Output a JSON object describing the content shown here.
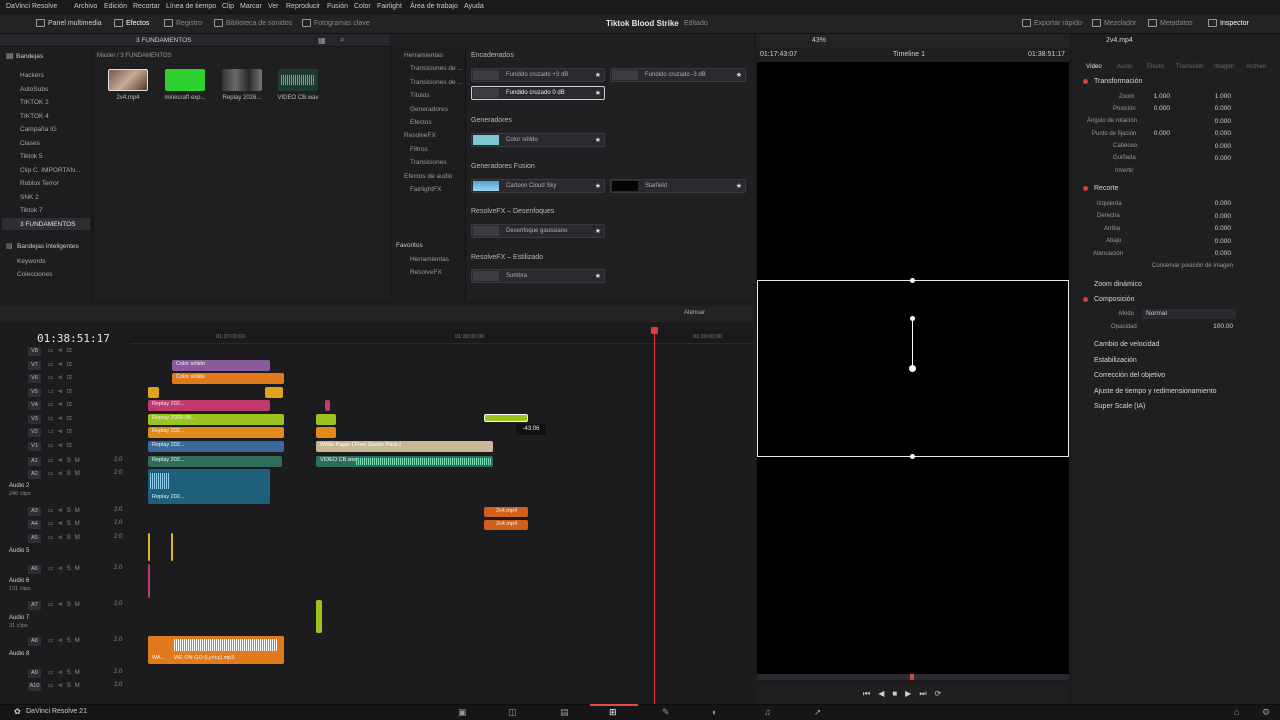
{
  "menubar": {
    "items": [
      "DaVinci Resolve",
      "Archivo",
      "Edición",
      "Recortar",
      "Línea de tiempo",
      "Clip",
      "Marcar",
      "Ver",
      "Reproducir",
      "Fusión",
      "Color",
      "Fairlight",
      "Área de trabajo",
      "Ayuda"
    ]
  },
  "toolbar": {
    "left": [
      "Panel multimedia",
      "Efectos",
      "Registro",
      "Biblioteca de sonidos",
      "Fotogramas clave"
    ],
    "project_title": "Tiktok Blood Strike",
    "project_status": "Editado",
    "right": [
      "Exportar rápido",
      "Mezclador",
      "Metadatos",
      "Inspector"
    ]
  },
  "media_pool": {
    "header": "Bandejas",
    "current_bin": "3 FUNDAMENTOS",
    "path": "Master / 3 FUNDAMENTOS",
    "bins": [
      "Hackers",
      "AutoSubs",
      "TIKTOK 2",
      "TIKTOK 4",
      "Campaña IG",
      "Clases",
      "Tiktok 5",
      "Clip C. IMPORTAN...",
      "Roblox Terror",
      "SNK 2",
      "Tiktok 7",
      "3 FUNDAMENTOS"
    ],
    "smart_header": "Bandejas inteligentes",
    "smart_bins": [
      "Keywords",
      "Colecciones"
    ],
    "clips": [
      {
        "name": "2v4.mp4"
      },
      {
        "name": "minecraft exp..."
      },
      {
        "name": "Replay 2026..."
      },
      {
        "name": "VIDEO CB.wav"
      }
    ]
  },
  "effects": {
    "tree": [
      "Herramientas",
      "Transiciones de ...",
      "Transiciones de ...",
      "Títulos",
      "Generadores",
      "Efectos",
      "ResolveFX",
      "Filtros",
      "Transiciones",
      "Efectos de audio",
      "FairlightFX"
    ],
    "favorites_header": "Favoritos",
    "favorites": [
      "Herramientas",
      "ResolveFX"
    ],
    "sections": [
      {
        "title": "Encadenados",
        "items": [
          "Fundido cruzado +3 dB",
          "Fundido cruzado -3 dB",
          "Fundido cruzado 0 dB"
        ]
      },
      {
        "title": "Generadores",
        "items": [
          "Color sólido"
        ]
      },
      {
        "title": "Generadores Fusion",
        "items": [
          "Cartoon Cloud Sky",
          "Starfield"
        ]
      },
      {
        "title": "ResolveFX – Desenfoques",
        "items": [
          "Desenfoque gaussiano"
        ]
      },
      {
        "title": "ResolveFX – Estilizado",
        "items": [
          "Sombra"
        ]
      }
    ]
  },
  "viewer": {
    "source_tc": "01:17:43:07",
    "zoom": "43%",
    "timeline_name": "Timeline 1",
    "record_tc": "01:38:51:17"
  },
  "timeline": {
    "timecode": "01:38:51:17",
    "ruler": [
      "01:37:00:00",
      "01:38:00:00",
      "01:39:00:00"
    ],
    "mute_label": "Atenuar",
    "tooltip": "-43:06",
    "video_tracks": [
      "V8",
      "V7",
      "V6",
      "V5",
      "V4",
      "V3",
      "V2",
      "V1"
    ],
    "audio_tracks": [
      {
        "id": "A1",
        "name": "",
        "vol": "2.0"
      },
      {
        "id": "A2",
        "name": "Audio 2",
        "sub": "246 clips",
        "vol": "2.0"
      },
      {
        "id": "A3",
        "name": "",
        "vol": "2.0"
      },
      {
        "id": "A4",
        "name": "",
        "vol": "2.0"
      },
      {
        "id": "A5",
        "name": "Audio 5",
        "vol": "2.0"
      },
      {
        "id": "A6",
        "name": "Audio 6",
        "sub": "131 clips",
        "vol": "2.0"
      },
      {
        "id": "A7",
        "name": "Audio 7",
        "sub": "31 clips",
        "vol": "2.0"
      },
      {
        "id": "A8",
        "name": "Audio 8",
        "vol": "2.0"
      },
      {
        "id": "A9",
        "name": "",
        "vol": "2.0"
      },
      {
        "id": "A10",
        "name": "",
        "vol": "2.0"
      }
    ],
    "clips": {
      "color1": "Color sólido",
      "color2": "Color sólido",
      "replay": "Replay 202...",
      "replay2": "Replay 2026-08...",
      "white": "White Paper | Free Starter Pack |",
      "video_cb": "VIDEO CB.wav",
      "v2v4a": "2v4.mp4",
      "v2v4b": "2v4.mp4",
      "music": "WE ON GO (Lyrics).mp3",
      "music_short": "WA..."
    }
  },
  "inspector": {
    "clip": "2v4.mp4",
    "tabs": [
      "Vídeo",
      "Audio",
      "Efecto",
      "Transición",
      "Imagen",
      "Archivo"
    ],
    "transform": {
      "title": "Transformación",
      "zoom_label": "Zoom",
      "zoom_x": "1.000",
      "zoom_y": "1.000",
      "pos_label": "Posición",
      "pos_x": "0.000",
      "pos_y": "0.000",
      "rot_label": "Ángulo de rotación",
      "rot": "0.000",
      "anchor_label": "Punto de fijación",
      "anchor_x": "0.000",
      "anchor_y": "0.000",
      "pitch_label": "Cabeceo",
      "pitch": "0.000",
      "yaw_label": "Guiñada",
      "yaw": "0.000",
      "flip_label": "Invertir"
    },
    "crop": {
      "title": "Recorte",
      "left_label": "Izquierda",
      "left": "0.000",
      "right_label": "Derecha",
      "right": "0.000",
      "top_label": "Arriba",
      "top": "0.000",
      "bottom_label": "Abajo",
      "bottom": "0.000",
      "soft_label": "Atenuación",
      "soft": "0.000",
      "retain": "Conservar posición de imagen"
    },
    "sections": [
      "Zoom dinámico",
      "Composición",
      "Cambio de velocidad",
      "Estabilización",
      "Corrección del objetivo",
      "Ajuste de tiempo y redimensionamiento",
      "Super Scale (IA)"
    ],
    "comp": {
      "mode_label": "Modo",
      "mode": "Normal",
      "opacity_label": "Opacidad",
      "opacity": "100.00"
    }
  },
  "footer": {
    "app": "DaVinci Resolve 21"
  },
  "colors": {
    "accent": "#e64b3c",
    "playhead": "#e03b3b",
    "selection": "#ffffff"
  }
}
